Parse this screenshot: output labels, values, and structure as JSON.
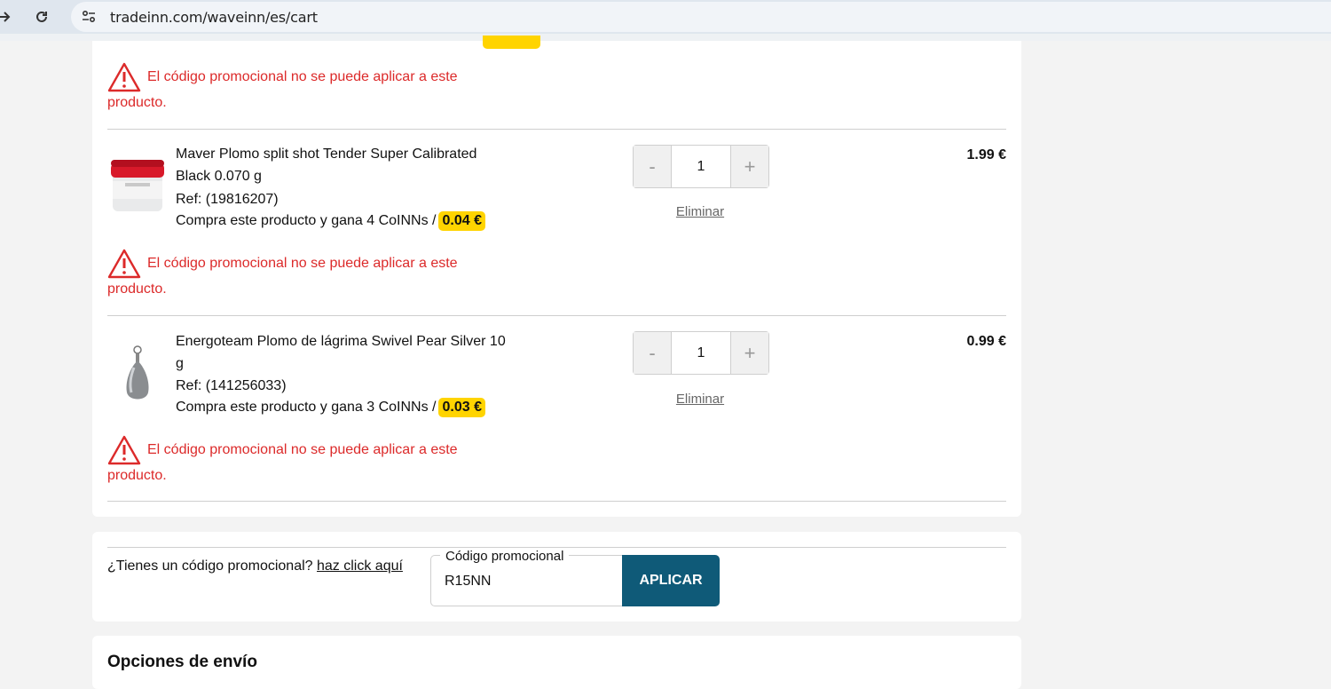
{
  "browser": {
    "url": "tradeinn.com/waveinn/es/cart"
  },
  "cart": {
    "warning_text": "El código promocional no se puede aplicar a este producto.",
    "remove_label": "Eliminar",
    "items": [
      {
        "title": "Maver Plomo split shot Tender Super Calibrated Black 0.070 g",
        "ref": "Ref: (19816207)",
        "coins_text": "Compra este producto y gana 4 CoINNs /",
        "coins_value": "0.04 €",
        "quantity": "1",
        "price": "1.99 €",
        "image_icon": "red-lid-jar"
      },
      {
        "title": "Energoteam Plomo de lágrima Swivel Pear Silver 10 g",
        "ref": "Ref: (141256033)",
        "coins_text": "Compra este producto y gana 3 CoINNs /",
        "coins_value": "0.03 €",
        "quantity": "1",
        "price": "0.99 €",
        "image_icon": "pear-sinker"
      }
    ],
    "minus_symbol": "-",
    "plus_symbol": "+"
  },
  "promo": {
    "question": "¿Tienes un código promocional?",
    "link": "haz click aquí",
    "field_label": "Código promocional",
    "field_value": "R15NN",
    "apply_label": "APLICAR"
  },
  "shipping": {
    "title": "Opciones de envío"
  },
  "colors": {
    "warning": "#dc2a2a",
    "coin_badge": "#ffd400",
    "apply_button": "#0f5a78"
  }
}
